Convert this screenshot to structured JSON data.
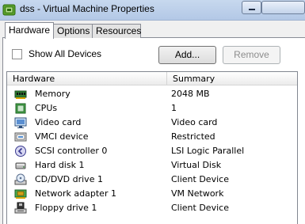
{
  "window": {
    "title": "dss - Virtual Machine Properties"
  },
  "tabs": [
    {
      "label": "Hardware",
      "active": true
    },
    {
      "label": "Options",
      "active": false
    },
    {
      "label": "Resources",
      "active": false
    }
  ],
  "toolbar": {
    "show_all_devices_label": "Show All Devices",
    "show_all_devices_checked": false,
    "add_label": "Add...",
    "remove_label": "Remove",
    "remove_enabled": false
  },
  "grid": {
    "columns": [
      "Hardware",
      "Summary"
    ],
    "rows": [
      {
        "icon": "memory-icon",
        "name": "Memory",
        "summary": "2048 MB"
      },
      {
        "icon": "cpu-icon",
        "name": "CPUs",
        "summary": "1"
      },
      {
        "icon": "video-card-icon",
        "name": "Video card",
        "summary": "Video card"
      },
      {
        "icon": "vmci-icon",
        "name": "VMCI device",
        "summary": "Restricted"
      },
      {
        "icon": "scsi-controller-icon",
        "name": "SCSI controller 0",
        "summary": "LSI Logic Parallel"
      },
      {
        "icon": "hard-disk-icon",
        "name": "Hard disk 1",
        "summary": "Virtual Disk"
      },
      {
        "icon": "cd-dvd-icon",
        "name": "CD/DVD drive 1",
        "summary": "Client Device"
      },
      {
        "icon": "network-adapter-icon",
        "name": "Network adapter 1",
        "summary": "VM Network"
      },
      {
        "icon": "floppy-icon",
        "name": "Floppy drive 1",
        "summary": "Client Device"
      }
    ]
  }
}
